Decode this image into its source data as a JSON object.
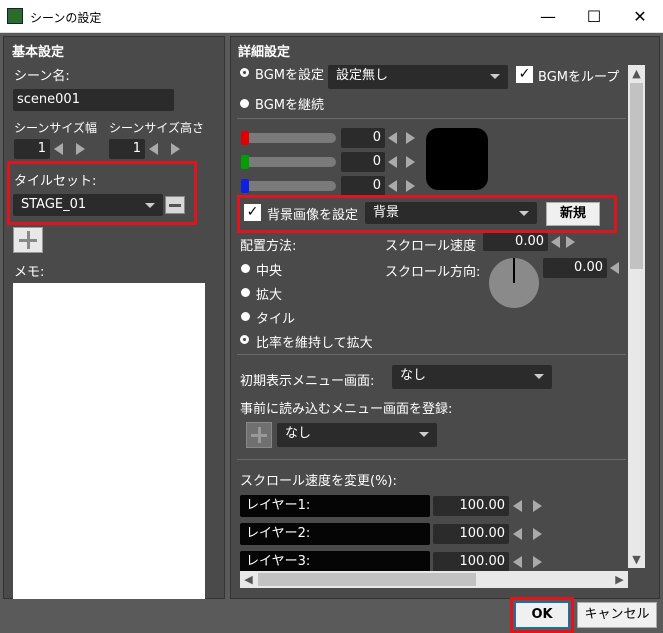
{
  "window": {
    "title": "シーンの設定",
    "minimize": "—",
    "maximize": "☐",
    "close": "✕"
  },
  "left": {
    "section_title": "基本設定",
    "scene_name_label": "シーン名:",
    "scene_name_value": "scene001",
    "size_width_label": "シーンサイズ幅",
    "size_height_label": "シーンサイズ高さ",
    "size_width_value": "1",
    "size_height_value": "1",
    "tileset_label": "タイルセット:",
    "tileset_value": "STAGE_01",
    "memo_label": "メモ:",
    "memo_value": ""
  },
  "right": {
    "section_title": "詳細設定",
    "bgm_set_label": "BGMを設定",
    "bgm_dropdown_value": "設定無し",
    "bgm_loop_label": "BGMをループ",
    "bgm_loop_checked": true,
    "bgm_continue_label": "BGMを継続",
    "rgb": [
      {
        "color": "#e00000",
        "value": "0"
      },
      {
        "color": "#00a000",
        "value": "0"
      },
      {
        "color": "#1020e0",
        "value": "0"
      }
    ],
    "preview_color": "#000000",
    "bg_image_label": "背景画像を設定",
    "bg_image_checked": true,
    "bg_image_value": "背景",
    "new_button": "新規",
    "placement_label": "配置方法:",
    "placement_options": [
      "中央",
      "拡大",
      "タイル",
      "比率を維持して拡大"
    ],
    "placement_selected": "比率を維持して拡大",
    "scroll_speed_label": "スクロール速度",
    "scroll_speed_value": "0.00",
    "scroll_dir_label": "スクロール方向:",
    "scroll_dir_value": "0.00",
    "initial_menu_label": "初期表示メニュー画面:",
    "initial_menu_value": "なし",
    "preload_menu_label": "事前に読み込むメニュー画面を登録:",
    "preload_menu_value": "なし",
    "scroll_change_label": "スクロール速度を変更(%):",
    "layers": [
      {
        "name": "レイヤー1:",
        "value": "100.00"
      },
      {
        "name": "レイヤー2:",
        "value": "100.00"
      },
      {
        "name": "レイヤー3:",
        "value": "100.00"
      }
    ]
  },
  "footer": {
    "ok": "OK",
    "cancel": "キャンセル"
  },
  "accent": "#e0141e"
}
